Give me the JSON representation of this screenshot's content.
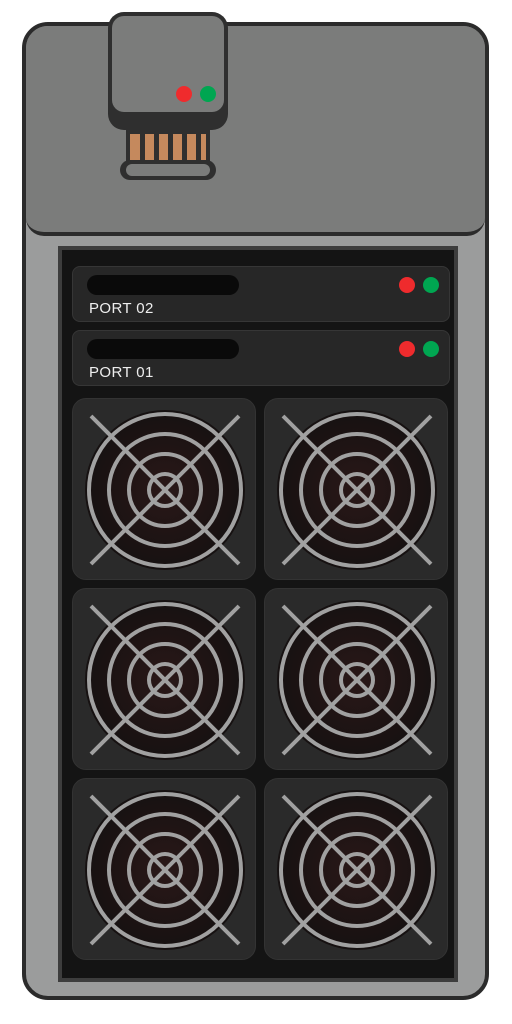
{
  "device": {
    "colors": {
      "shell_top": "#7b7c7b",
      "shell_outline": "#2b2b2b",
      "frame": "#9b9c9c",
      "rack_bg": "#141414",
      "panel": "#272727",
      "led_red": "#ef2b2d",
      "led_green": "#00a651",
      "connector_contacts": "#c5895d"
    },
    "usb_stick": {
      "icon": "usb-stick-icon",
      "leds": [
        "red",
        "green"
      ]
    },
    "ports": [
      {
        "label": "PORT 02",
        "leds": [
          "red",
          "green"
        ]
      },
      {
        "label": "PORT 01",
        "leds": [
          "red",
          "green"
        ]
      }
    ],
    "fans": {
      "icon": "fan-icon",
      "count": 6
    }
  }
}
